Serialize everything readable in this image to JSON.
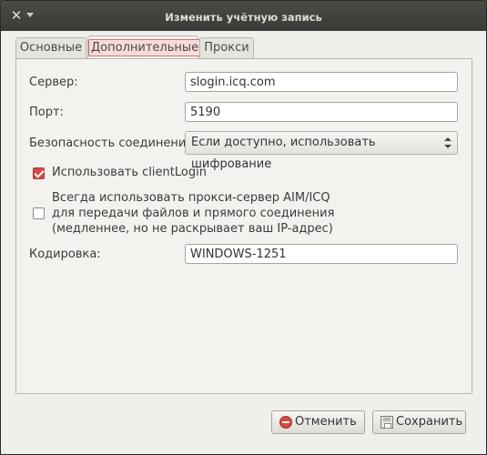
{
  "window": {
    "title": "Изменить учётную запись"
  },
  "tabs": [
    {
      "label": "Основные"
    },
    {
      "label": "Дополнительные"
    },
    {
      "label": "Прокси"
    }
  ],
  "form": {
    "server": {
      "label": "Сервер:",
      "value": "slogin.icq.com"
    },
    "port": {
      "label": "Порт:",
      "value": "5190"
    },
    "security": {
      "label": "Безопасность соединения:",
      "value": "Если доступно, использовать шифрование"
    },
    "client_login": {
      "label": "Использовать clientLogin",
      "checked": true
    },
    "proxy": {
      "label_line1": "Всегда использовать прокси-сервер AIM/ICQ",
      "label_line2": "для передачи файлов и прямого соединения",
      "label_line3": "(медленнее, но не раскрывает ваш IP-адрес)",
      "checked": false
    },
    "encoding": {
      "label": "Кодировка:",
      "value": "WINDOWS-1251"
    }
  },
  "buttons": {
    "cancel": "Отменить",
    "save": "Сохранить"
  },
  "colors": {
    "checkbox_checked": "#d24b46",
    "active_tab_highlight": "#f6dcd8"
  }
}
